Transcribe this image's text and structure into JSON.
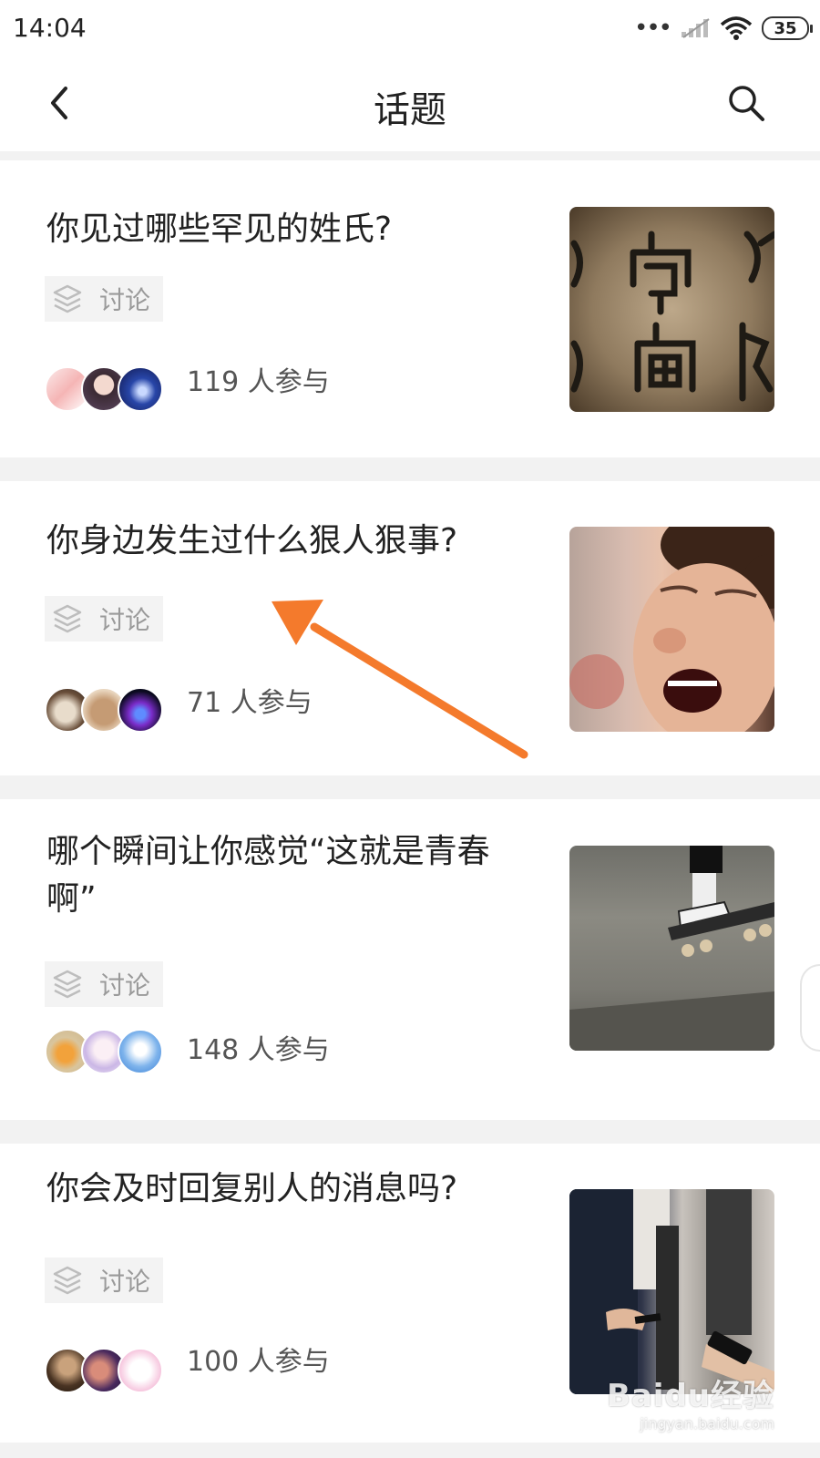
{
  "status_bar": {
    "time": "14:04",
    "dots": "•••",
    "battery": "35"
  },
  "header": {
    "title": "话题",
    "back_icon": "chevron-left-icon",
    "search_icon": "search-icon"
  },
  "topics": [
    {
      "title": "你见过哪些罕见的姓氏?",
      "tag": "讨论",
      "participants": "119 人参与"
    },
    {
      "title": "你身边发生过什么狠人狠事?",
      "tag": "讨论",
      "participants": "71 人参与"
    },
    {
      "title": "哪个瞬间让你感觉“这就是青春啊”",
      "tag": "讨论",
      "participants": "148 人参与"
    },
    {
      "title": "你会及时回复别人的消息吗?",
      "tag": "讨论",
      "participants": "100 人参与"
    }
  ],
  "colors": {
    "annotation_arrow": "#f47a2c",
    "tag_text": "#9a9a9a",
    "band": "#f2f2f2"
  },
  "watermark": {
    "logo": "Baidu经验",
    "url": "jingyan.baidu.com"
  }
}
